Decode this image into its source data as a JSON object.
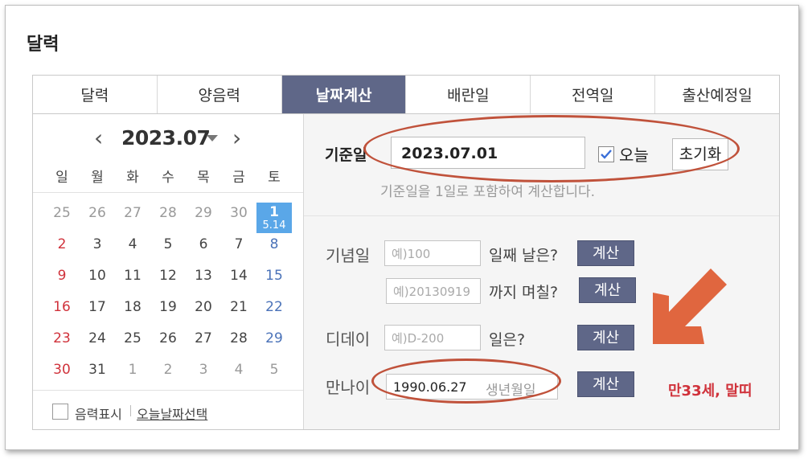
{
  "page_title": "달력",
  "tabs": [
    {
      "label": "달력",
      "active": false
    },
    {
      "label": "양음력",
      "active": false
    },
    {
      "label": "날짜계산",
      "active": true
    },
    {
      "label": "배란일",
      "active": false
    },
    {
      "label": "전역일",
      "active": false
    },
    {
      "label": "출산예정일",
      "active": false
    }
  ],
  "calendar": {
    "month_label": "2023.07",
    "prev_icon": "chevron-left-icon",
    "next_icon": "chevron-right-icon",
    "weekdays": [
      "일",
      "월",
      "화",
      "수",
      "목",
      "금",
      "토"
    ],
    "weeks": [
      [
        "25",
        "26",
        "27",
        "28",
        "29",
        "30",
        "1"
      ],
      [
        "2",
        "3",
        "4",
        "5",
        "6",
        "7",
        "8"
      ],
      [
        "9",
        "10",
        "11",
        "12",
        "13",
        "14",
        "15"
      ],
      [
        "16",
        "17",
        "18",
        "19",
        "20",
        "21",
        "22"
      ],
      [
        "23",
        "24",
        "25",
        "26",
        "27",
        "28",
        "29"
      ],
      [
        "30",
        "31",
        "1",
        "2",
        "3",
        "4",
        "5"
      ]
    ],
    "today_lunar": "5.14",
    "lunar_toggle_label": "음력표시",
    "today_select_label": "오늘날짜선택",
    "colors": {
      "sunday": "#d0323b",
      "saturday": "#4a72b8",
      "today_bg": "#5aa7e8",
      "other_month": "#999999"
    }
  },
  "calculator": {
    "ref_label": "기준일",
    "ref_value": "2023.07.01",
    "today_checkbox_label": "오늘",
    "today_checked": true,
    "reset_label": "초기화",
    "ref_note": "기준일을 1일로 포함하여 계산합니다.",
    "anniversary_label": "기념일",
    "anniversary_placeholder": "예)100",
    "anniversary_suffix": "일째 날은?",
    "until_placeholder": "예)20130919",
    "until_suffix": "까지 며칠?",
    "dday_label": "디데이",
    "dday_placeholder": "예)D-200",
    "dday_suffix": "일은?",
    "age_label": "만나이",
    "age_value": "1990.06.27",
    "age_placeholder": "생년월일",
    "calc_label": "계산",
    "age_result": "만33세, 말띠"
  },
  "annotation": {
    "color": "#c0523b",
    "arrow_color": "#e0663f",
    "arrow_icon": "arrow-down-left-icon"
  }
}
